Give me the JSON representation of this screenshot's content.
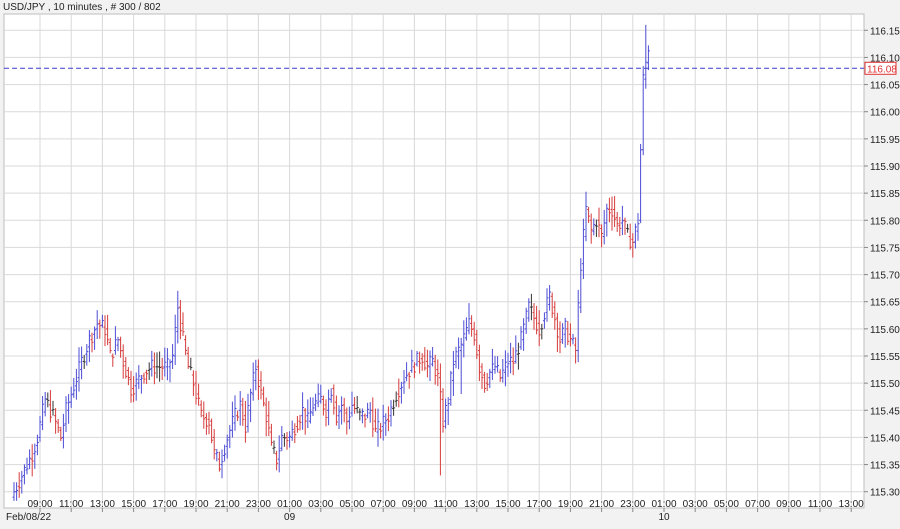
{
  "header": {
    "symbol_line": "USD/JPY , 10 minutes , # 300 / 802"
  },
  "colors": {
    "background": "#ffffff",
    "grid": "#d9d9d9",
    "bar_up": "#4b4bd6",
    "bar_down": "#d63a3a",
    "bar_flat": "#333333",
    "current_line": "#3b3bd0",
    "current_box_border": "#e03030",
    "axis_text": "#222222"
  },
  "chart_data": {
    "type": "ohlc",
    "title": "USD/JPY , 10 minutes , # 300 / 802",
    "timeframe": "10 minutes",
    "bars_shown": "300 / 802",
    "ylim": [
      115.27,
      116.18
    ],
    "y_ticks": [
      "116.15",
      "116.10",
      "116.05",
      "116.00",
      "115.95",
      "115.90",
      "115.85",
      "115.80",
      "115.75",
      "115.70",
      "115.65",
      "115.60",
      "115.55",
      "115.50",
      "115.45",
      "115.40",
      "115.35",
      "115.30"
    ],
    "x_ticks": [
      "09:00",
      "11:00",
      "13:00",
      "15:00",
      "17:00",
      "19:00",
      "21:00",
      "23:00",
      "01:00",
      "03:00",
      "05:00",
      "07:00",
      "09:00",
      "11:00",
      "13:00",
      "15:00",
      "17:00",
      "19:00",
      "21:00",
      "23:00",
      "01:00",
      "03:00",
      "05:00",
      "07:00",
      "09:00",
      "11:00",
      "13:00"
    ],
    "date_labels": [
      {
        "text": "Feb/08/22",
        "at_tick": 0
      },
      {
        "text": "09",
        "at_tick": 8
      },
      {
        "text": "10",
        "at_tick": 20
      }
    ],
    "current_price": 116.08,
    "current_price_label": "116.08",
    "grid": true,
    "path": [
      [
        0,
        115.3
      ],
      [
        4,
        115.34
      ],
      [
        7,
        115.37
      ],
      [
        9,
        115.4
      ],
      [
        12,
        115.47
      ],
      [
        15,
        115.44
      ],
      [
        18,
        115.4
      ],
      [
        20,
        115.45
      ],
      [
        22,
        115.48
      ],
      [
        26,
        115.54
      ],
      [
        29,
        115.58
      ],
      [
        32,
        115.61
      ],
      [
        35,
        115.6
      ],
      [
        37,
        115.55
      ],
      [
        40,
        115.58
      ],
      [
        42,
        115.54
      ],
      [
        45,
        115.49
      ],
      [
        47,
        115.5
      ],
      [
        50,
        115.52
      ],
      [
        53,
        115.53
      ],
      [
        56,
        115.53
      ],
      [
        59,
        115.53
      ],
      [
        61,
        115.55
      ],
      [
        63,
        115.64
      ],
      [
        65,
        115.58
      ],
      [
        67,
        115.53
      ],
      [
        69,
        115.5
      ],
      [
        72,
        115.44
      ],
      [
        75,
        115.43
      ],
      [
        77,
        115.37
      ],
      [
        79,
        115.35
      ],
      [
        82,
        115.4
      ],
      [
        85,
        115.44
      ],
      [
        87,
        115.46
      ],
      [
        89,
        115.42
      ],
      [
        91,
        115.48
      ],
      [
        93,
        115.53
      ],
      [
        95,
        115.48
      ],
      [
        97,
        115.44
      ],
      [
        99,
        115.38
      ],
      [
        101,
        115.36
      ],
      [
        103,
        115.4
      ],
      [
        106,
        115.4
      ],
      [
        109,
        115.43
      ],
      [
        111,
        115.45
      ],
      [
        113,
        115.43
      ],
      [
        115,
        115.46
      ],
      [
        118,
        115.47
      ],
      [
        120,
        115.45
      ],
      [
        122,
        115.49
      ],
      [
        124,
        115.44
      ],
      [
        126,
        115.46
      ],
      [
        128,
        115.43
      ],
      [
        130,
        115.46
      ],
      [
        133,
        115.44
      ],
      [
        135,
        115.44
      ],
      [
        137,
        115.45
      ],
      [
        139,
        115.41
      ],
      [
        141,
        115.42
      ],
      [
        144,
        115.44
      ],
      [
        147,
        115.48
      ],
      [
        150,
        115.51
      ],
      [
        153,
        115.53
      ],
      [
        155,
        115.54
      ],
      [
        157,
        115.55
      ],
      [
        159,
        115.53
      ],
      [
        161,
        115.54
      ],
      [
        163,
        115.51
      ],
      [
        165,
        115.43
      ],
      [
        167,
        115.47
      ],
      [
        169,
        115.54
      ],
      [
        172,
        115.57
      ],
      [
        175,
        115.61
      ],
      [
        177,
        115.59
      ],
      [
        179,
        115.53
      ],
      [
        181,
        115.5
      ],
      [
        183,
        115.52
      ],
      [
        185,
        115.53
      ],
      [
        187,
        115.51
      ],
      [
        190,
        115.54
      ],
      [
        192,
        115.54
      ],
      [
        195,
        115.58
      ],
      [
        198,
        115.64
      ],
      [
        200,
        115.62
      ],
      [
        202,
        115.6
      ],
      [
        204,
        115.63
      ],
      [
        206,
        115.66
      ],
      [
        208,
        115.62
      ],
      [
        210,
        115.58
      ],
      [
        212,
        115.6
      ],
      [
        214,
        115.58
      ],
      [
        216,
        115.56
      ],
      [
        218,
        115.72
      ],
      [
        220,
        115.82
      ],
      [
        222,
        115.78
      ],
      [
        224,
        115.8
      ],
      [
        226,
        115.77
      ],
      [
        228,
        115.82
      ],
      [
        230,
        115.82
      ],
      [
        232,
        115.79
      ],
      [
        234,
        115.8
      ],
      [
        236,
        115.77
      ],
      [
        238,
        115.76
      ],
      [
        240,
        115.8
      ],
      [
        242,
        116.06
      ],
      [
        244,
        116.12
      ]
    ],
    "spikes": [
      {
        "i": 164,
        "low": 115.33
      },
      {
        "i": 172,
        "low": 115.48
      },
      {
        "i": 243,
        "high": 116.16
      },
      {
        "i": 63,
        "high": 115.67
      }
    ],
    "bar_count": 245,
    "x_per_tick_bars": 12,
    "first_tick_bar_offset": 10
  }
}
